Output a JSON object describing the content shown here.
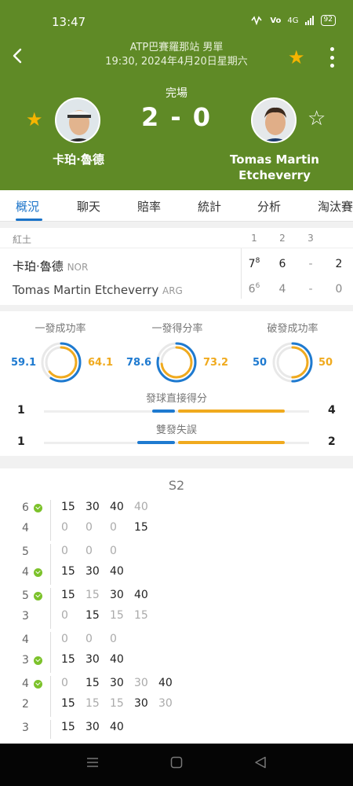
{
  "statusbar": {
    "time": "13:47",
    "network": "4G",
    "battery": "92"
  },
  "header": {
    "title_line1": "ATP巴賽羅那站 男單",
    "title_line2": "19:30, 2024年4月20日星期六",
    "status": "完場",
    "score": "2 - 0",
    "player1": {
      "name": "卡珀·魯德",
      "favorited": true
    },
    "player2": {
      "name_line1": "Tomas Martin",
      "name_line2": "Etcheverry",
      "favorited": false
    }
  },
  "tabs": [
    "概況",
    "聊天",
    "賠率",
    "統計",
    "分析",
    "淘汰賽"
  ],
  "active_tab": "概況",
  "scoreboard": {
    "surface": "紅土",
    "set_headers": [
      "1",
      "2",
      "3"
    ],
    "rows": [
      {
        "name": "卡珀·魯德",
        "country": "NOR",
        "s1": "7",
        "s1_tb": "8",
        "s2": "6",
        "s3": "-",
        "total": "2"
      },
      {
        "name": "Tomas Martin Etcheverry",
        "country": "ARG",
        "s1": "6",
        "s1_tb": "6",
        "s2": "4",
        "s3": "-",
        "total": "0"
      }
    ]
  },
  "stats": {
    "gauges": [
      {
        "title": "一發成功率",
        "left": "59.1",
        "right": "64.1",
        "left_pct": 59.1,
        "right_pct": 64.1
      },
      {
        "title": "一發得分率",
        "left": "78.6",
        "right": "73.2",
        "left_pct": 78.6,
        "right_pct": 73.2
      },
      {
        "title": "破發成功率",
        "left": "50",
        "right": "50",
        "left_pct": 50,
        "right_pct": 50
      }
    ],
    "bars": [
      {
        "title": "發球直接得分",
        "left": "1",
        "right": "4",
        "left_val": 1,
        "right_val": 4
      },
      {
        "title": "雙發失誤",
        "left": "1",
        "right": "2",
        "left_val": 1,
        "right_val": 2
      }
    ]
  },
  "pbp": {
    "set_label": "S2",
    "games": [
      {
        "top_score": "6",
        "top_serve": true,
        "top_pts": [
          [
            "15",
            "w"
          ],
          [
            "30",
            "w"
          ],
          [
            "40",
            "w"
          ],
          [
            "40",
            "l"
          ]
        ],
        "bot_score": "4",
        "bot_serve": false,
        "bot_pts": [
          [
            "0",
            "l"
          ],
          [
            "0",
            "l"
          ],
          [
            "0",
            "l"
          ],
          [
            "15",
            "w"
          ]
        ]
      },
      {
        "top_score": "5",
        "top_serve": false,
        "top_pts": [
          [
            "0",
            "l"
          ],
          [
            "0",
            "l"
          ],
          [
            "0",
            "l"
          ]
        ],
        "bot_score": "4",
        "bot_serve": true,
        "bot_pts": [
          [
            "15",
            "w"
          ],
          [
            "30",
            "w"
          ],
          [
            "40",
            "w"
          ]
        ]
      },
      {
        "top_score": "5",
        "top_serve": true,
        "top_pts": [
          [
            "15",
            "w"
          ],
          [
            "15",
            "l"
          ],
          [
            "30",
            "w"
          ],
          [
            "40",
            "w"
          ]
        ],
        "bot_score": "3",
        "bot_serve": false,
        "bot_pts": [
          [
            "0",
            "l"
          ],
          [
            "15",
            "w"
          ],
          [
            "15",
            "l"
          ],
          [
            "15",
            "l"
          ]
        ]
      },
      {
        "top_score": "4",
        "top_serve": false,
        "top_pts": [
          [
            "0",
            "l"
          ],
          [
            "0",
            "l"
          ],
          [
            "0",
            "l"
          ]
        ],
        "bot_score": "3",
        "bot_serve": true,
        "bot_pts": [
          [
            "15",
            "w"
          ],
          [
            "30",
            "w"
          ],
          [
            "40",
            "w"
          ]
        ]
      },
      {
        "top_score": "4",
        "top_serve": true,
        "top_pts": [
          [
            "0",
            "l"
          ],
          [
            "15",
            "w"
          ],
          [
            "30",
            "w"
          ],
          [
            "30",
            "l"
          ],
          [
            "40",
            "w"
          ]
        ],
        "bot_score": "2",
        "bot_serve": false,
        "bot_pts": [
          [
            "15",
            "w"
          ],
          [
            "15",
            "l"
          ],
          [
            "15",
            "l"
          ],
          [
            "30",
            "w"
          ],
          [
            "30",
            "l"
          ]
        ]
      },
      {
        "top_score": "3",
        "top_serve": false,
        "top_pts": [
          [
            "15",
            "w"
          ],
          [
            "30",
            "w"
          ],
          [
            "40",
            "w"
          ]
        ],
        "bot_score": "",
        "bot_serve": false,
        "bot_pts": []
      }
    ]
  },
  "colors": {
    "header_bg": "#5f8a26",
    "accent": "#1a73c9",
    "star": "#f5b400",
    "p1": "#1e7ad0",
    "p2": "#f0aa1e"
  }
}
